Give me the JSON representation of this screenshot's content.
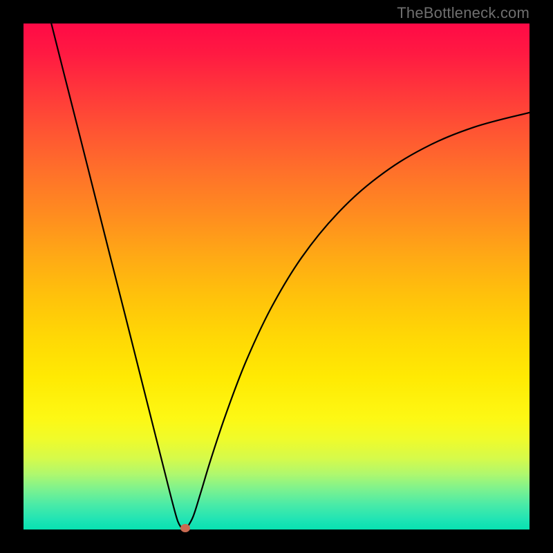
{
  "watermark": "TheBottleneck.com",
  "chart_data": {
    "type": "line",
    "title": "",
    "xlabel": "",
    "ylabel": "",
    "xlim": [
      0,
      100
    ],
    "ylim": [
      0,
      100
    ],
    "grid": false,
    "legend": false,
    "series": [
      {
        "name": "left-branch",
        "x": [
          5.5,
          8,
          11,
          14,
          17,
          20,
          23,
          26,
          28,
          29.5,
          30.5,
          31.3
        ],
        "y": [
          100,
          90.1,
          78.3,
          66.4,
          54.5,
          42.7,
          30.8,
          18.9,
          11.0,
          5.1,
          1.6,
          0.2
        ]
      },
      {
        "name": "right-branch",
        "x": [
          32.2,
          33.5,
          35,
          37,
          40,
          44,
          49,
          55,
          62,
          70,
          79,
          89,
          100
        ],
        "y": [
          0.2,
          2.5,
          7.2,
          13.8,
          22.8,
          33.3,
          43.9,
          53.8,
          62.4,
          69.6,
          75.3,
          79.5,
          82.4
        ]
      }
    ],
    "marker": {
      "x": 32.0,
      "y": 0.3,
      "color": "#c96a51"
    },
    "background_gradient": {
      "top": "#ff0a46",
      "bottom": "#07e1b1"
    }
  }
}
